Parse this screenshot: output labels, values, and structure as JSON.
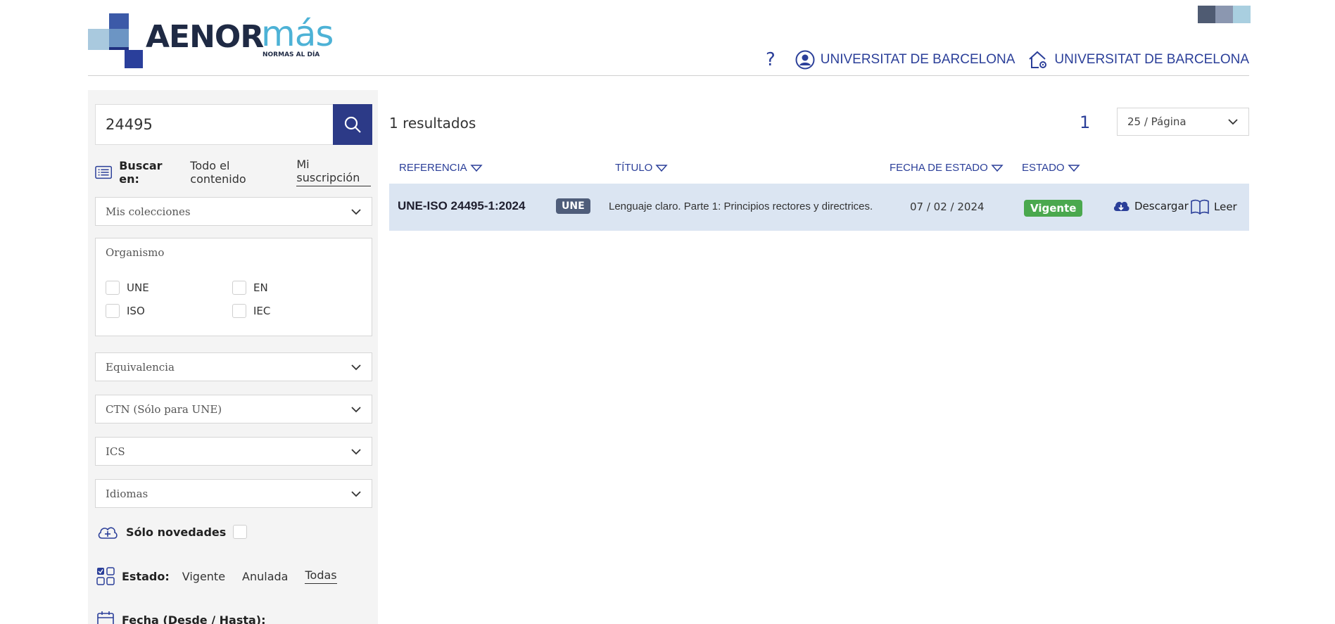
{
  "logo": {
    "brand": "AENOR",
    "accent": "más",
    "tagline": "NORMAS AL DÍA"
  },
  "header": {
    "help_label": "?",
    "user_label": "UNIVERSITAT DE BARCELONA",
    "institution_label": "UNIVERSITAT DE BARCELONA"
  },
  "search": {
    "value": "24495",
    "search_in_label": "Buscar en:",
    "search_in_options": [
      "Todo el contenido",
      "Mi suscripción"
    ],
    "search_in_selected": "Mi suscripción"
  },
  "filters": {
    "collections_label": "Mis colecciones",
    "organismo": {
      "title": "Organismo",
      "options": [
        "UNE",
        "EN",
        "ISO",
        "IEC"
      ]
    },
    "equivalencia_label": "Equivalencia",
    "ctn_label": "CTN (Sólo para UNE)",
    "ics_label": "ICS",
    "idiomas_label": "Idiomas",
    "novedades_label": "Sólo novedades",
    "estado_label": "Estado:",
    "estado_options": [
      "Vigente",
      "Anulada",
      "Todas"
    ],
    "estado_selected": "Todas",
    "fecha_label": "Fecha (Desde / Hasta):"
  },
  "results": {
    "count_label": "1 resultados",
    "page": "1",
    "per_page": "25 / Página",
    "columns": [
      "REFERENCIA",
      "TÍTULO",
      "FECHA DE ESTADO",
      "ESTADO"
    ],
    "rows": [
      {
        "referencia": "UNE-ISO 24495-1:2024",
        "organismo": "UNE",
        "titulo": "Lenguaje claro. Parte 1: Principios rectores y directrices.",
        "fecha": "07 / 02 / 2024",
        "estado": "Vigente",
        "download_label": "Descargar",
        "read_label": "Leer"
      }
    ]
  },
  "colors": {
    "primary": "#2c3a87",
    "link": "#2b3f99",
    "accent_cyan": "#4db2d6",
    "row_bg": "#dbe5f2",
    "status_green": "#4aa84e"
  }
}
